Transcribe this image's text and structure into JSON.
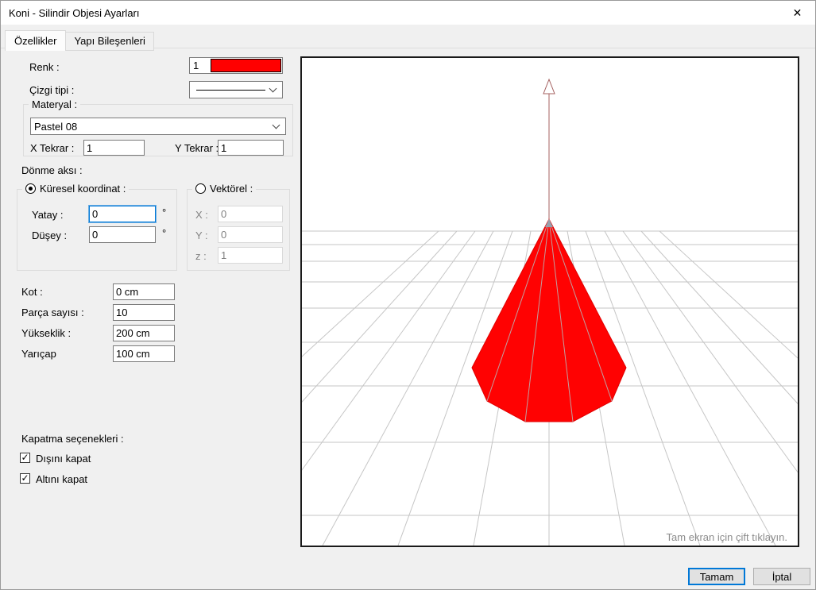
{
  "window": {
    "title": "Koni - Silindir Objesi Ayarları"
  },
  "icons": {
    "close": "✕",
    "checkmark": "✓"
  },
  "colors": {
    "accent": "#0078d7",
    "object_color": "#ff0000"
  },
  "tabs": {
    "ozellikler": "Özellikler",
    "yapi_bilesenleri": "Yapı Bileşenleri"
  },
  "fields": {
    "renk_label": "Renk :",
    "renk_pen_number": "1",
    "cizgi_tipi_label": "Çizgi tipi :",
    "materyal_label": "Materyal :",
    "materyal_value": "Pastel 08",
    "x_tekrar_label": "X Tekrar :",
    "x_tekrar_value": "1",
    "y_tekrar_label": "Y Tekrar :",
    "y_tekrar_value": "1",
    "donme_aksi_label": "Dönme aksı :",
    "kuresel_label": "Küresel koordinat :",
    "yatay_label": "Yatay :",
    "yatay_value": "0",
    "degree_unit": "°",
    "dusey_label": "Düşey :",
    "dusey_value": "0",
    "vektorel_label": "Vektörel :",
    "vx_label": "X :",
    "vx_value": "0",
    "vy_label": "Y :",
    "vy_value": "0",
    "vz_label": "z :",
    "vz_value": "1",
    "kot_label": "Kot :",
    "kot_value": "0 cm",
    "parca_sayisi_label": "Parça sayısı :",
    "parca_sayisi_value": "10",
    "yukseklik_label": "Yükseklik :",
    "yukseklik_value": "200 cm",
    "yaricap_label": "Yarıçap",
    "yaricap_value": "100 cm",
    "kapatma_label": "Kapatma seçenekleri :",
    "disini_kapat_label": "Dışını kapat",
    "disini_kapat_checked": true,
    "altini_kapat_label": "Altını kapat",
    "altini_kapat_checked": true
  },
  "preview": {
    "hint": "Tam ekran için çift tıklayın."
  },
  "buttons": {
    "ok": "Tamam",
    "cancel": "İptal"
  }
}
